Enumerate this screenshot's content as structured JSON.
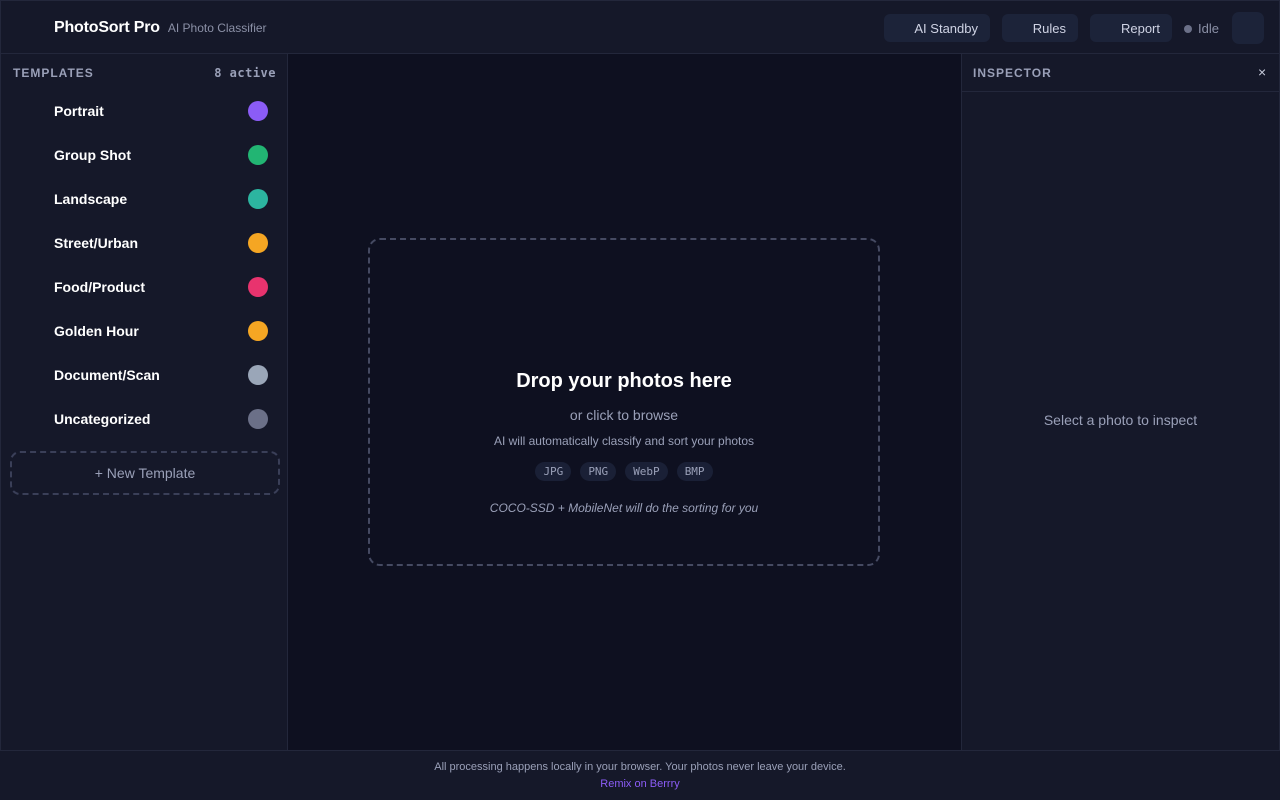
{
  "header": {
    "title": "PhotoSort Pro",
    "subtitle": "AI Photo Classifier",
    "buttons": {
      "ai_standby": "AI Standby",
      "rules": "Rules",
      "report": "Report"
    },
    "status": "Idle"
  },
  "sidebar": {
    "heading": "TEMPLATES",
    "active_count": "8 active",
    "items": [
      {
        "label": "Portrait",
        "color": "#8b5cf6"
      },
      {
        "label": "Group Shot",
        "color": "#22b573"
      },
      {
        "label": "Landscape",
        "color": "#2cb5a0"
      },
      {
        "label": "Street/Urban",
        "color": "#f5a623"
      },
      {
        "label": "Food/Product",
        "color": "#e8336e"
      },
      {
        "label": "Golden Hour",
        "color": "#f5a623"
      },
      {
        "label": "Document/Scan",
        "color": "#9aa6b8"
      },
      {
        "label": "Uncategorized",
        "color": "#6b7088"
      }
    ],
    "new_template": "+ New Template"
  },
  "dropzone": {
    "title": "Drop your photos here",
    "or_browse": "or click to browse",
    "description": "AI will automatically classify and sort your photos",
    "formats": [
      "JPG",
      "PNG",
      "WebP",
      "BMP"
    ],
    "note": "COCO-SSD + MobileNet will do the sorting for you"
  },
  "inspector": {
    "title": "INSPECTOR",
    "close": "×",
    "empty": "Select a photo to inspect"
  },
  "footer": {
    "text": "All processing happens locally in your browser. Your photos never leave your device.",
    "link": "Remix on Berrry"
  }
}
